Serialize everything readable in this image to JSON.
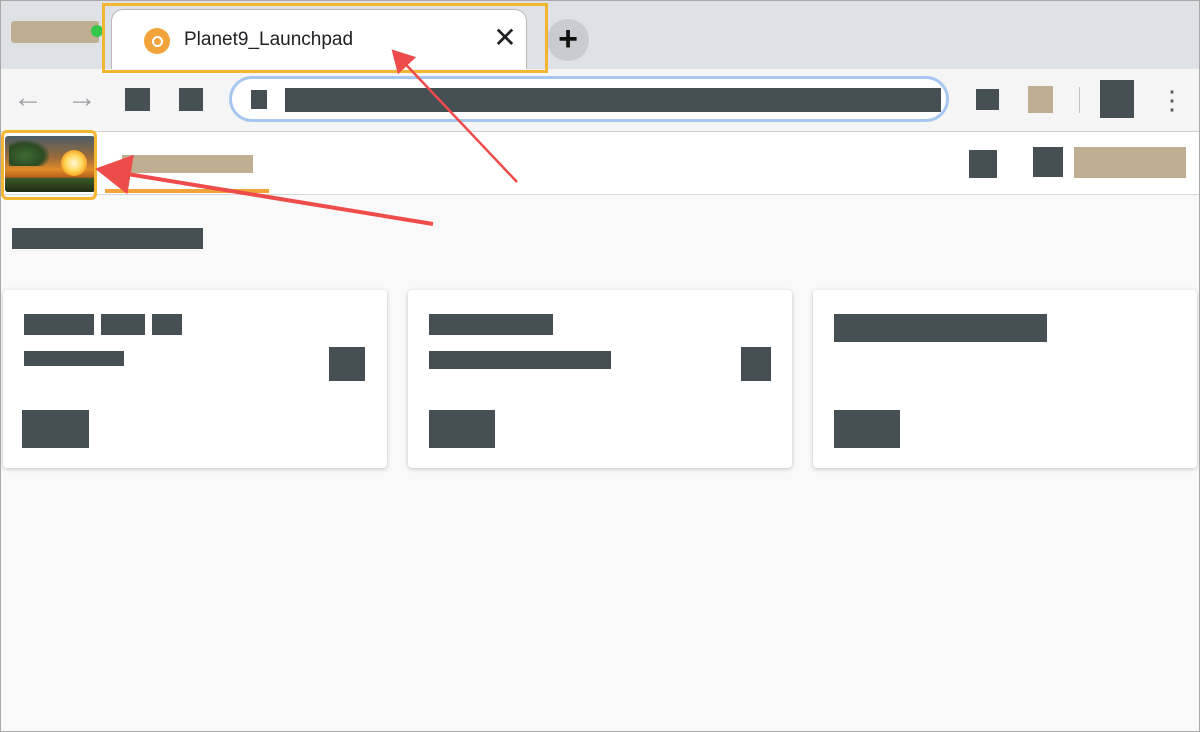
{
  "browser": {
    "active_tab": {
      "title": "Planet9_Launchpad",
      "favicon_icon": "launchpad-favicon-icon",
      "close_glyph": "✕"
    },
    "new_tab_glyph": "+",
    "back_glyph": "←",
    "forward_glyph": "→",
    "menu_glyph": "⋮"
  },
  "colors": {
    "highlight": "#f2b632",
    "arrow": "#ee4b4b",
    "redacted_text": "#464f53",
    "redacted_accent": "#bfae91",
    "header_underline": "#f2a33a"
  },
  "app_header": {
    "logo_icon": "sunset-landscape-logo"
  },
  "annotations": [
    {
      "target": "active-tab",
      "type": "arrow"
    },
    {
      "target": "app-logo",
      "type": "arrow"
    }
  ]
}
